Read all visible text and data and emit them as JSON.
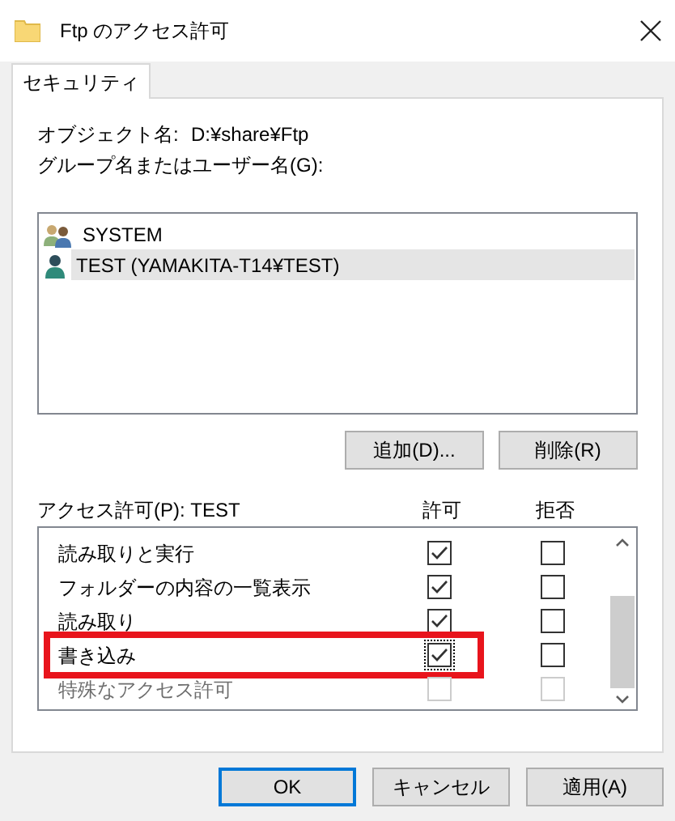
{
  "window": {
    "title": "Ftp のアクセス許可"
  },
  "tabs": [
    {
      "label": "セキュリティ",
      "selected": true
    }
  ],
  "object": {
    "label": "オブジェクト名:",
    "value": "D:¥share¥Ftp"
  },
  "users_label": "グループ名またはユーザー名(G):",
  "users": [
    {
      "name": "SYSTEM",
      "kind": "group",
      "selected": false
    },
    {
      "name": "TEST (YAMAKITA-T14¥TEST)",
      "kind": "user",
      "selected": true
    }
  ],
  "user_buttons": [
    "追加(D)...",
    "削除(R)"
  ],
  "permissions": {
    "label": "アクセス許可(P): TEST",
    "columns": [
      "許可",
      "拒否"
    ],
    "rows": [
      {
        "name": "読み取りと実行",
        "allow": true,
        "deny": false,
        "disabled": false,
        "highlighted": false,
        "focused": false
      },
      {
        "name": "フォルダーの内容の一覧表示",
        "allow": true,
        "deny": false,
        "disabled": false,
        "highlighted": false,
        "focused": false
      },
      {
        "name": "読み取り",
        "allow": true,
        "deny": false,
        "disabled": false,
        "highlighted": false,
        "focused": false
      },
      {
        "name": "書き込み",
        "allow": true,
        "deny": false,
        "disabled": false,
        "highlighted": true,
        "focused": true
      },
      {
        "name": "特殊なアクセス許可",
        "allow": false,
        "deny": false,
        "disabled": true,
        "highlighted": false,
        "focused": false
      }
    ]
  },
  "buttons": [
    {
      "label": "OK",
      "default": true
    },
    {
      "label": "キャンセル",
      "default": false
    },
    {
      "label": "適用(A)",
      "default": false
    }
  ]
}
